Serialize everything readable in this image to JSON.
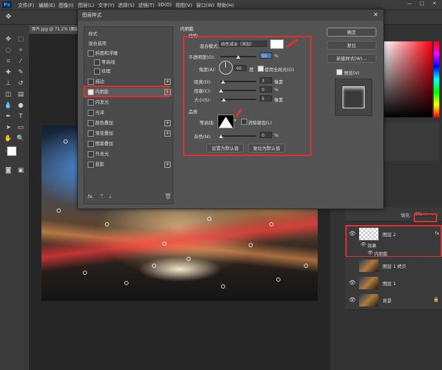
{
  "menubar": {
    "logo": "Ps",
    "items": [
      "文件(F)",
      "编辑(E)",
      "图像(I)",
      "图层(L)",
      "文字(Y)",
      "选择(S)",
      "滤镜(T)",
      "3D(D)",
      "视图(V)",
      "窗口(W)",
      "帮助(H)"
    ],
    "min": "—",
    "max": "□",
    "close": "✕"
  },
  "document": {
    "tab": "原片.jpg @ 71.2% (图层..."
  },
  "dialog": {
    "title": "图层样式",
    "close": "✕",
    "styles_header": "样式",
    "blend_options": "混合选项",
    "items": [
      {
        "label": "斜面和浮雕",
        "checked": false,
        "plus": false
      },
      {
        "label": "等高线",
        "checked": false,
        "plus": false,
        "sub": true
      },
      {
        "label": "纹理",
        "checked": false,
        "plus": false,
        "sub": true
      },
      {
        "label": "描边",
        "checked": false,
        "plus": true
      },
      {
        "label": "内阴影",
        "checked": true,
        "plus": true
      },
      {
        "label": "内发光",
        "checked": false,
        "plus": false
      },
      {
        "label": "光泽",
        "checked": false,
        "plus": false
      },
      {
        "label": "颜色叠加",
        "checked": false,
        "plus": true
      },
      {
        "label": "渐变叠加",
        "checked": false,
        "plus": true
      },
      {
        "label": "图案叠加",
        "checked": false,
        "plus": false
      },
      {
        "label": "外发光",
        "checked": false,
        "plus": false
      },
      {
        "label": "投影",
        "checked": false,
        "plus": true
      }
    ],
    "fx": "fx.",
    "section_title": "内阴影",
    "structure": "结构",
    "blend_mode_label": "混合模式：",
    "blend_mode_value": "线性减淡（添加）",
    "opacity_label": "不透明度(O):",
    "opacity_value": "50",
    "angle_label": "角度(A):",
    "angle_value": "90",
    "degree": "度",
    "global_light": "使用全局光(G)",
    "distance_label": "距离(D):",
    "distance_value": "3",
    "choke_label": "阻塞(C):",
    "choke_value": "0",
    "size_label": "大小(S):",
    "size_value": "5",
    "px": "像素",
    "pct": "%",
    "quality": "品质",
    "contour_label": "等高线:",
    "antialias": "消除锯齿(L)",
    "noise_label": "杂色(N):",
    "noise_value": "0",
    "btn_default": "设置为默认值",
    "btn_reset": "复位为默认值",
    "ok": "确定",
    "reset": "复位",
    "new_style": "新建样式(W)...",
    "preview": "预览(V)"
  },
  "layers": {
    "rows": [
      {
        "name": "图层 2",
        "fx": "fx"
      },
      {
        "name": "效果"
      },
      {
        "name": "内阴影"
      },
      {
        "name": "图层 1 拷贝"
      },
      {
        "name": "图层 1"
      },
      {
        "name": "背景"
      }
    ],
    "fill_label": "填充:",
    "fill_value": "0%"
  },
  "colors": {
    "accent_red": "#e53030",
    "panel": "#535353"
  }
}
